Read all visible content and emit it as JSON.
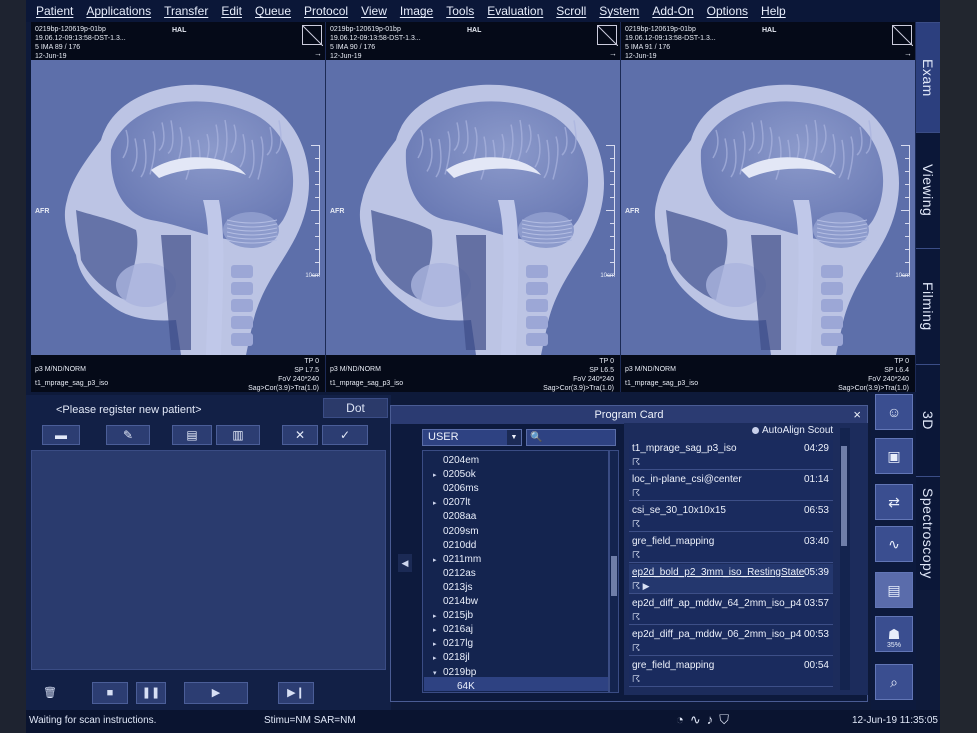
{
  "menu": [
    "Patient",
    "Applications",
    "Transfer",
    "Edit",
    "Queue",
    "Protocol",
    "View",
    "Image",
    "Tools",
    "Evaluation",
    "Scroll",
    "System",
    "Add-On",
    "Options",
    "Help"
  ],
  "viewers": [
    {
      "h1": "0219bp-120619p-01bp",
      "h2": "19.06.12-09:13:58-DST-1.3...",
      "h3": "5 IMA 89 / 176",
      "h4": "12-Jun-19",
      "hal": "HAL",
      "afr": "AFR",
      "scale": "10cm",
      "tp": "TP 0",
      "sp": "SP L7.5",
      "fov": "FoV 240*240",
      "orient": "Sag>Cor(3.9)>Tra(1.0)",
      "mode": "p3 M/ND/NORM",
      "seq": "t1_mprage_sag_p3_iso"
    },
    {
      "h1": "0219bp-120619p-01bp",
      "h2": "19.06.12-09:13:58-DST-1.3...",
      "h3": "5 IMA 90 / 176",
      "h4": "12-Jun-19",
      "hal": "HAL",
      "afr": "AFR",
      "scale": "10cm",
      "tp": "TP 0",
      "sp": "SP L6.5",
      "fov": "FoV 240*240",
      "orient": "Sag>Cor(3.9)>Tra(1.0)",
      "mode": "p3 M/ND/NORM",
      "seq": "t1_mprage_sag_p3_iso"
    },
    {
      "h1": "0219bp-120619p-01bp",
      "h2": "19.06.12-09:13:58-DST-1.3...",
      "h3": "5 IMA 91 / 176",
      "h4": "12-Jun-19",
      "hal": "HAL",
      "afr": "AFR",
      "scale": "10cm",
      "tp": "TP 0",
      "sp": "SP L6.4",
      "fov": "FoV 240*240",
      "orient": "Sag>Cor(3.9)>Tra(1.0)",
      "mode": "p3 M/ND/NORM",
      "seq": "t1_mprage_sag_p3_iso"
    }
  ],
  "side_tabs": [
    "Exam",
    "Viewing",
    "Filming",
    "3D",
    "Spectroscopy"
  ],
  "patient_panel": {
    "title": "<Please register new patient>",
    "dot": "Dot"
  },
  "program_card": {
    "title": "Program Card",
    "close": "×",
    "user_select": "USER",
    "autoalign": "AutoAlign Scout",
    "tree": [
      {
        "label": "0204em",
        "arrow": ""
      },
      {
        "label": "0205ok",
        "arrow": "▸"
      },
      {
        "label": "0206ms",
        "arrow": ""
      },
      {
        "label": "0207lt",
        "arrow": "▸"
      },
      {
        "label": "0208aa",
        "arrow": ""
      },
      {
        "label": "0209sm",
        "arrow": ""
      },
      {
        "label": "0210dd",
        "arrow": ""
      },
      {
        "label": "0211mm",
        "arrow": "▸"
      },
      {
        "label": "0212as",
        "arrow": ""
      },
      {
        "label": "0213js",
        "arrow": ""
      },
      {
        "label": "0214bw",
        "arrow": ""
      },
      {
        "label": "0215jb",
        "arrow": "▸"
      },
      {
        "label": "0216aj",
        "arrow": "▸"
      },
      {
        "label": "0217lg",
        "arrow": "▸"
      },
      {
        "label": "0218jl",
        "arrow": "▸"
      },
      {
        "label": "0219bp",
        "arrow": "▾"
      },
      {
        "label": "64K",
        "arrow": ""
      }
    ],
    "protocols": [
      {
        "name": "t1_mprage_sag_p3_iso",
        "time": "04:29"
      },
      {
        "name": "loc_in-plane_csi@center",
        "time": "01:14"
      },
      {
        "name": "csi_se_30_10x10x15",
        "time": "06:53"
      },
      {
        "name": "gre_field_mapping",
        "time": "03:40"
      },
      {
        "name": "ep2d_bold_p2_3mm_iso_RestingState",
        "time": "05:39"
      },
      {
        "name": "ep2d_diff_ap_mddw_64_2mm_iso_p4",
        "time": "03:57"
      },
      {
        "name": "ep2d_diff_pa_mddw_06_2mm_iso_p4",
        "time": "00:53"
      },
      {
        "name": "gre_field_mapping",
        "time": "00:54"
      }
    ]
  },
  "toolbar": {
    "percent": "35%"
  },
  "status": {
    "message": "Waiting for scan instructions.",
    "stim": "Stimu=NM SAR=NM",
    "datetime": "12-Jun-19 11:35:05"
  }
}
